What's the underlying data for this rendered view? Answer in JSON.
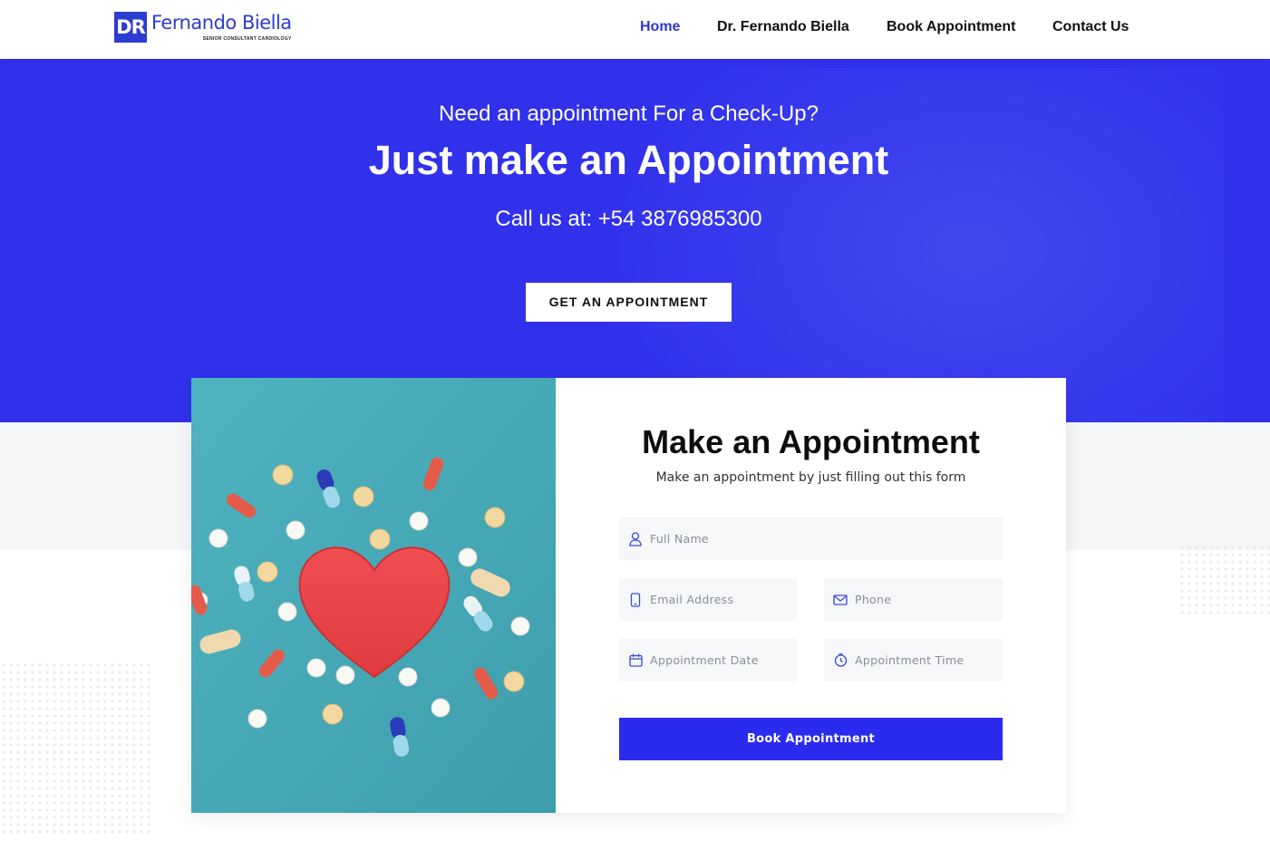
{
  "brand": {
    "mark": "DR",
    "name": "Fernando Biella",
    "tagline": "SENIOR CONSULTANT CARDIOLOGY",
    "color": "#2c3ccf"
  },
  "nav": {
    "items": [
      {
        "label": "Home",
        "active": true
      },
      {
        "label": "Dr. Fernando Biella",
        "active": false
      },
      {
        "label": "Book Appointment",
        "active": false
      },
      {
        "label": "Contact Us",
        "active": false
      }
    ],
    "active_color": "#2c35d8"
  },
  "hero": {
    "subtitle": "Need an appointment For a Check-Up?",
    "title": "Just make an Appointment",
    "phone": "Call us at: +54 3876985300",
    "cta": "GET AN APPOINTMENT",
    "background": "#3131ec"
  },
  "form": {
    "image_alt": "heart-and-pills-image",
    "title": "Make an Appointment",
    "subtitle": "Make an appointment by just filling out this form",
    "fields": {
      "name": {
        "placeholder": "Full Name",
        "icon": "user-icon"
      },
      "email": {
        "placeholder": "Email Address",
        "icon": "phone-device-icon"
      },
      "phone": {
        "placeholder": "Phone",
        "icon": "envelope-icon"
      },
      "date": {
        "placeholder": "Appointment Date",
        "icon": "calendar-icon"
      },
      "time": {
        "placeholder": "Appointment Time",
        "icon": "clock-icon"
      }
    },
    "submit": "Book Appointment",
    "button_color": "#2b2bef"
  }
}
